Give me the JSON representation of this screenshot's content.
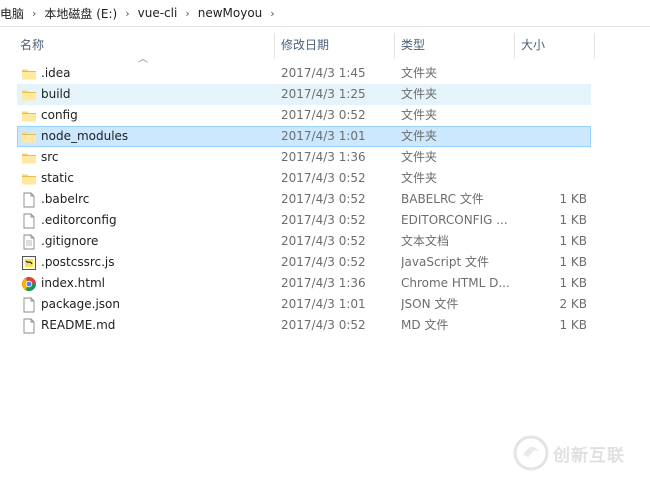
{
  "breadcrumb": [
    "电脑",
    "本地磁盘 (E:)",
    "vue-cli",
    "newMoyou"
  ],
  "columns": {
    "name": "名称",
    "date": "修改日期",
    "type": "类型",
    "size": "大小"
  },
  "rows": [
    {
      "name": ".idea",
      "date": "2017/4/3 1:45",
      "type": "文件夹",
      "size": "",
      "icon": "folder-icon",
      "state": "normal"
    },
    {
      "name": "build",
      "date": "2017/4/3 1:25",
      "type": "文件夹",
      "size": "",
      "icon": "folder-icon",
      "state": "hover"
    },
    {
      "name": "config",
      "date": "2017/4/3 0:52",
      "type": "文件夹",
      "size": "",
      "icon": "folder-icon",
      "state": "normal"
    },
    {
      "name": "node_modules",
      "date": "2017/4/3 1:01",
      "type": "文件夹",
      "size": "",
      "icon": "folder-icon",
      "state": "selected"
    },
    {
      "name": "src",
      "date": "2017/4/3 1:36",
      "type": "文件夹",
      "size": "",
      "icon": "folder-icon",
      "state": "normal"
    },
    {
      "name": "static",
      "date": "2017/4/3 0:52",
      "type": "文件夹",
      "size": "",
      "icon": "folder-icon",
      "state": "normal"
    },
    {
      "name": ".babelrc",
      "date": "2017/4/3 0:52",
      "type": "BABELRC 文件",
      "size": "1 KB",
      "icon": "file-icon",
      "state": "normal"
    },
    {
      "name": ".editorconfig",
      "date": "2017/4/3 0:52",
      "type": "EDITORCONFIG ...",
      "size": "1 KB",
      "icon": "file-icon",
      "state": "normal"
    },
    {
      "name": ".gitignore",
      "date": "2017/4/3 0:52",
      "type": "文本文档",
      "size": "1 KB",
      "icon": "text-file-icon",
      "state": "normal"
    },
    {
      "name": ".postcssrc.js",
      "date": "2017/4/3 0:52",
      "type": "JavaScript 文件",
      "size": "1 KB",
      "icon": "javascript-file-icon",
      "state": "normal"
    },
    {
      "name": "index.html",
      "date": "2017/4/3 1:36",
      "type": "Chrome HTML D...",
      "size": "1 KB",
      "icon": "chrome-icon",
      "state": "normal"
    },
    {
      "name": "package.json",
      "date": "2017/4/3 1:01",
      "type": "JSON 文件",
      "size": "2 KB",
      "icon": "file-icon",
      "state": "normal"
    },
    {
      "name": "README.md",
      "date": "2017/4/3 0:52",
      "type": "MD 文件",
      "size": "1 KB",
      "icon": "file-icon",
      "state": "normal"
    }
  ],
  "watermark": {
    "text": "创新互联"
  }
}
